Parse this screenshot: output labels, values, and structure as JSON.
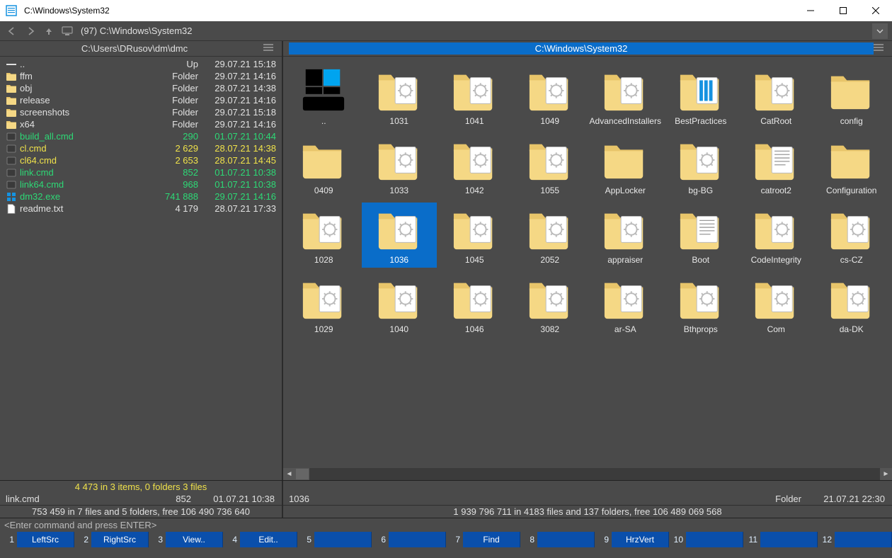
{
  "window": {
    "title": "C:\\Windows\\System32"
  },
  "toolbar": {
    "address": "(97) C:\\Windows\\System32"
  },
  "left": {
    "path": "C:\\Users\\DRusov\\dm\\dmc",
    "items": [
      {
        "icon": "up",
        "name": "..",
        "size": "Up",
        "date": "29.07.21 15:18",
        "color": "c-white"
      },
      {
        "icon": "folder",
        "name": "ffm",
        "size": "Folder",
        "date": "29.07.21 14:16",
        "color": "c-white"
      },
      {
        "icon": "folder",
        "name": "obj",
        "size": "Folder",
        "date": "28.07.21 14:38",
        "color": "c-white"
      },
      {
        "icon": "folder",
        "name": "release",
        "size": "Folder",
        "date": "29.07.21 14:16",
        "color": "c-white"
      },
      {
        "icon": "folder",
        "name": "screenshots",
        "size": "Folder",
        "date": "29.07.21 15:18",
        "color": "c-white"
      },
      {
        "icon": "folder",
        "name": "x64",
        "size": "Folder",
        "date": "29.07.21 14:16",
        "color": "c-white"
      },
      {
        "icon": "bat",
        "name": "build_all.cmd",
        "size": "290",
        "date": "01.07.21 10:44",
        "color": "c-green"
      },
      {
        "icon": "bat",
        "name": "cl.cmd",
        "size": "2 629",
        "date": "28.07.21 14:38",
        "color": "c-yellow"
      },
      {
        "icon": "bat",
        "name": "cl64.cmd",
        "size": "2 653",
        "date": "28.07.21 14:45",
        "color": "c-yellow"
      },
      {
        "icon": "bat",
        "name": "link.cmd",
        "size": "852",
        "date": "01.07.21 10:38",
        "color": "c-green"
      },
      {
        "icon": "bat",
        "name": "link64.cmd",
        "size": "968",
        "date": "01.07.21 10:38",
        "color": "c-green"
      },
      {
        "icon": "exe",
        "name": "dm32.exe",
        "size": "741 888",
        "date": "29.07.21 14:16",
        "color": "c-green"
      },
      {
        "icon": "file",
        "name": "readme.txt",
        "size": "4 179",
        "date": "28.07.21 17:33",
        "color": "c-white"
      }
    ],
    "selectionSummary": "4 473 in 3 items, 0 folders 3 files",
    "current": {
      "name": "link.cmd",
      "size": "852",
      "date": "01.07.21 10:38"
    },
    "stats": "753 459 in 7 files and 5 folders, free 106 490 736 640"
  },
  "right": {
    "path": "C:\\Windows\\System32",
    "items": [
      {
        "label": "..",
        "variant": "drive",
        "selected": false
      },
      {
        "label": "1031",
        "variant": "gear",
        "selected": false
      },
      {
        "label": "1041",
        "variant": "gear",
        "selected": false
      },
      {
        "label": "1049",
        "variant": "gear",
        "selected": false
      },
      {
        "label": "AdvancedInstallers",
        "variant": "gear",
        "selected": false
      },
      {
        "label": "BestPractices",
        "variant": "bars",
        "selected": false
      },
      {
        "label": "CatRoot",
        "variant": "gear",
        "selected": false
      },
      {
        "label": "config",
        "variant": "plain",
        "selected": false
      },
      {
        "label": "0409",
        "variant": "plain",
        "selected": false
      },
      {
        "label": "1033",
        "variant": "gear",
        "selected": false
      },
      {
        "label": "1042",
        "variant": "gear",
        "selected": false
      },
      {
        "label": "1055",
        "variant": "gear",
        "selected": false
      },
      {
        "label": "AppLocker",
        "variant": "plain",
        "selected": false
      },
      {
        "label": "bg-BG",
        "variant": "gear",
        "selected": false
      },
      {
        "label": "catroot2",
        "variant": "text",
        "selected": false
      },
      {
        "label": "Configuration",
        "variant": "plain",
        "selected": false
      },
      {
        "label": "1028",
        "variant": "gear",
        "selected": false
      },
      {
        "label": "1036",
        "variant": "gear",
        "selected": true
      },
      {
        "label": "1045",
        "variant": "gear",
        "selected": false
      },
      {
        "label": "2052",
        "variant": "gear",
        "selected": false
      },
      {
        "label": "appraiser",
        "variant": "gear",
        "selected": false
      },
      {
        "label": "Boot",
        "variant": "text",
        "selected": false
      },
      {
        "label": "CodeIntegrity",
        "variant": "gear",
        "selected": false
      },
      {
        "label": "cs-CZ",
        "variant": "gear",
        "selected": false
      },
      {
        "label": "1029",
        "variant": "gear",
        "selected": false
      },
      {
        "label": "1040",
        "variant": "gear",
        "selected": false
      },
      {
        "label": "1046",
        "variant": "gear",
        "selected": false
      },
      {
        "label": "3082",
        "variant": "gear",
        "selected": false
      },
      {
        "label": "ar-SA",
        "variant": "gear",
        "selected": false
      },
      {
        "label": "Bthprops",
        "variant": "gear",
        "selected": false
      },
      {
        "label": "Com",
        "variant": "gear",
        "selected": false
      },
      {
        "label": "da-DK",
        "variant": "gear",
        "selected": false
      }
    ],
    "current": {
      "name": "1036",
      "size": "Folder",
      "date": "21.07.21 22:30"
    },
    "stats": "1 939 796 711 in 4183 files and 137 folders, free 106 489 069 568"
  },
  "cmdline": {
    "placeholder": "<Enter command and press ENTER>"
  },
  "fnkeys": [
    {
      "num": "1",
      "label": "LeftSrc"
    },
    {
      "num": "2",
      "label": "RightSrc"
    },
    {
      "num": "3",
      "label": "View.."
    },
    {
      "num": "4",
      "label": "Edit.."
    },
    {
      "num": "5",
      "label": ""
    },
    {
      "num": "6",
      "label": ""
    },
    {
      "num": "7",
      "label": "Find"
    },
    {
      "num": "8",
      "label": ""
    },
    {
      "num": "9",
      "label": "HrzVert"
    },
    {
      "num": "10",
      "label": ""
    },
    {
      "num": "11",
      "label": ""
    },
    {
      "num": "12",
      "label": ""
    }
  ]
}
